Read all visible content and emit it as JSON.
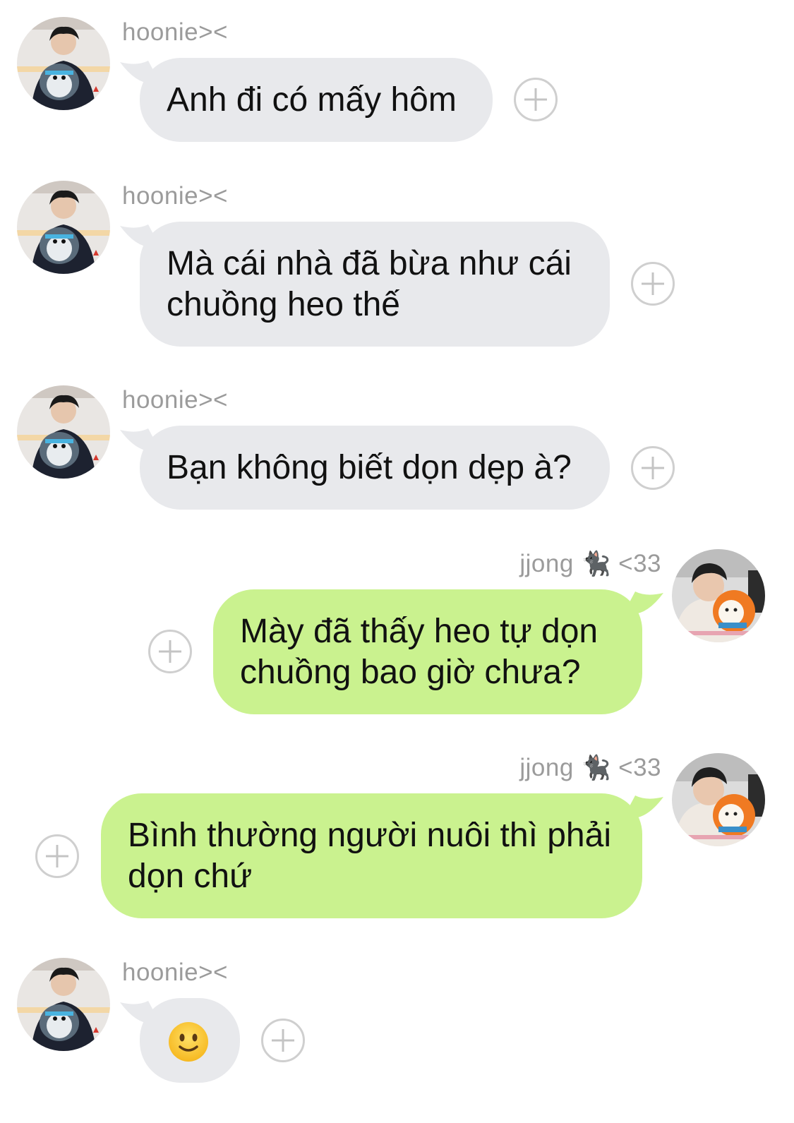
{
  "chat": {
    "messages": [
      {
        "sender": "hoonie><",
        "side": "incoming",
        "lines": [
          "Anh đi có mấy hôm"
        ]
      },
      {
        "sender": "hoonie><",
        "side": "incoming",
        "lines": [
          "Mà cái nhà đã bừa như cái",
          "chuồng heo thế"
        ]
      },
      {
        "sender": "hoonie><",
        "side": "incoming",
        "lines": [
          "Bạn không biết dọn dẹp à?"
        ]
      },
      {
        "sender_name": "jjong",
        "sender_emoji": "🐈‍⬛",
        "sender_suffix": "<33",
        "side": "outgoing",
        "lines": [
          "Mày đã thấy heo tự dọn",
          "chuồng bao giờ chưa?"
        ]
      },
      {
        "sender_name": "jjong",
        "sender_emoji": "🐈‍⬛",
        "sender_suffix": "<33",
        "side": "outgoing",
        "lines": [
          "Bình thường người nuôi thì phải",
          "dọn chứ"
        ]
      },
      {
        "sender": "hoonie><",
        "side": "incoming",
        "emoji": "slightly-smiling-face-icon"
      }
    ]
  },
  "colors": {
    "incoming_bubble": "#e8e9ec",
    "outgoing_bubble": "#caf28f",
    "sender_text": "#9b9b9b",
    "add_button": "#cfcfcf"
  }
}
